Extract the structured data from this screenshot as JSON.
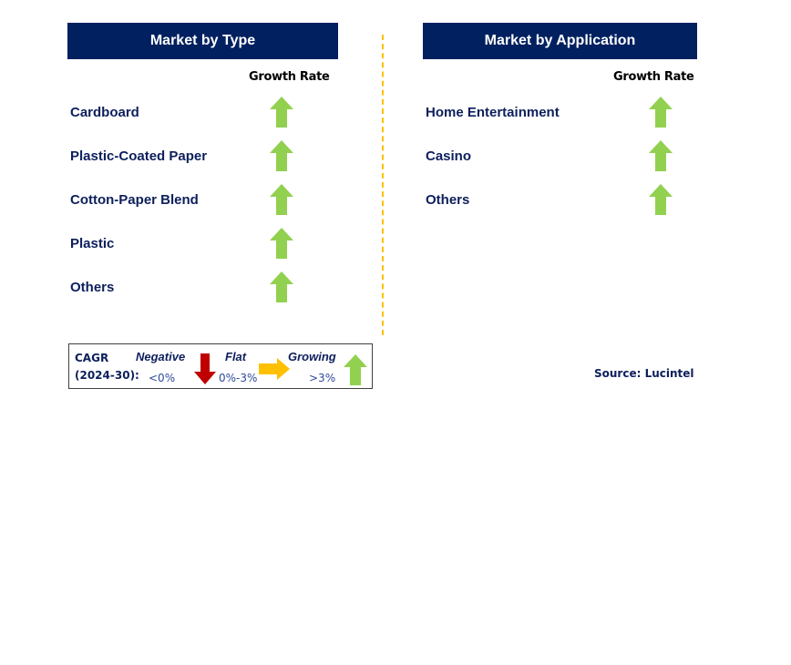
{
  "colors": {
    "header_bg": "#002060",
    "growing": "#92d050",
    "negative": "#c00000",
    "flat": "#ffc000",
    "text": "#0d1f5c"
  },
  "market_by_type": {
    "title": "Market by Type",
    "column_header": "Growth Rate",
    "items": [
      {
        "label": "Cardboard",
        "trend": "growing"
      },
      {
        "label": "Plastic-Coated Paper",
        "trend": "growing"
      },
      {
        "label": "Cotton-Paper Blend",
        "trend": "growing"
      },
      {
        "label": "Plastic",
        "trend": "growing"
      },
      {
        "label": "Others",
        "trend": "growing"
      }
    ]
  },
  "market_by_application": {
    "title": "Market by Application",
    "column_header": "Growth Rate",
    "items": [
      {
        "label": "Home Entertainment",
        "trend": "growing"
      },
      {
        "label": "Casino",
        "trend": "growing"
      },
      {
        "label": "Others",
        "trend": "growing"
      }
    ]
  },
  "legend": {
    "cagr_label": "CAGR",
    "period_label": "(2024-30):",
    "negative": {
      "label": "Negative",
      "range": "<0%",
      "icon": "down-arrow-icon"
    },
    "flat": {
      "label": "Flat",
      "range": "0%-3%",
      "icon": "right-arrow-icon"
    },
    "growing": {
      "label": "Growing",
      "range": ">3%",
      "icon": "up-arrow-icon"
    }
  },
  "source": "Source: Lucintel"
}
